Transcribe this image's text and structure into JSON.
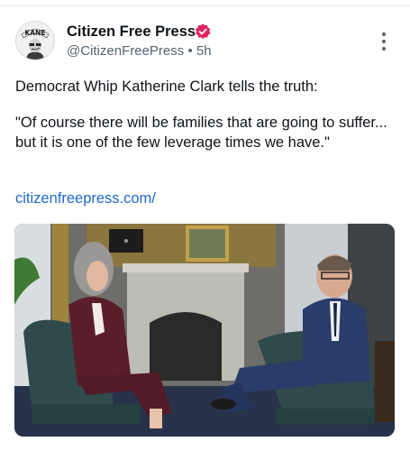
{
  "post": {
    "author": {
      "display_name": "Citizen Free Press",
      "handle": "@CitizenFreePress",
      "separator": "•",
      "time": "5h",
      "avatar_text": "KANE",
      "verified": true
    },
    "text_lines": [
      "Democrat Whip Katherine Clark tells the truth:",
      "\"Of course there will be families that are going to suffer... but it is one of the few leverage times we have.\""
    ],
    "link": "citizenfreepress.com/",
    "media": {
      "type": "video"
    }
  },
  "icons": {
    "verified": "verified-badge-icon",
    "more": "more-options-icon"
  },
  "colors": {
    "verified_badge": "#e0245e",
    "link": "#1d68c9",
    "secondary_text": "#536471"
  }
}
